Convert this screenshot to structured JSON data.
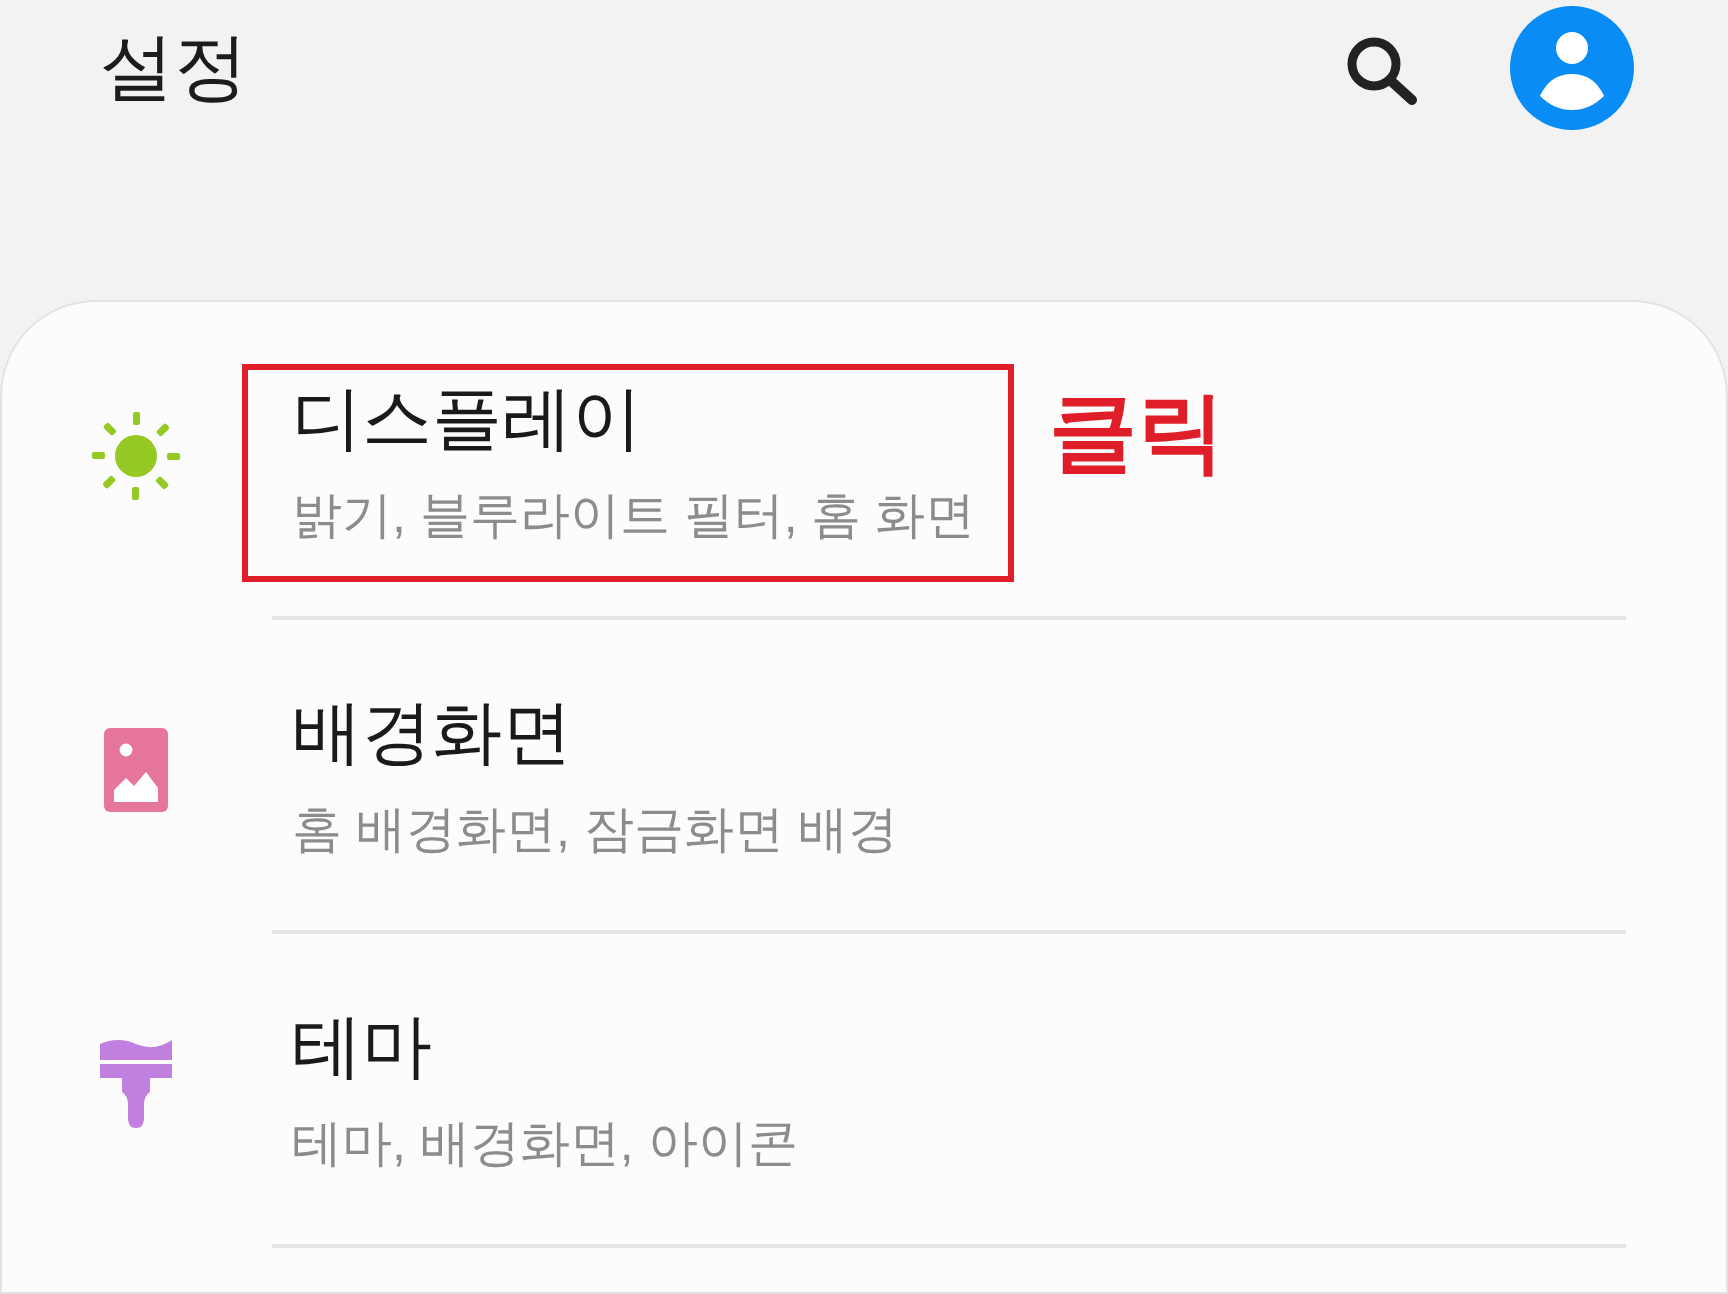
{
  "header": {
    "title": "설정"
  },
  "items": [
    {
      "kind": "display",
      "title": "디스플레이",
      "subtitle": "밝기, 블루라이트 필터, 홈 화면",
      "highlighted": true,
      "callout": "클릭"
    },
    {
      "kind": "wallpaper",
      "title": "배경화면",
      "subtitle": "홈 배경화면, 잠금화면 배경",
      "highlighted": false
    },
    {
      "kind": "theme",
      "title": "테마",
      "subtitle": "테마, 배경화면, 아이콘",
      "highlighted": false
    }
  ]
}
